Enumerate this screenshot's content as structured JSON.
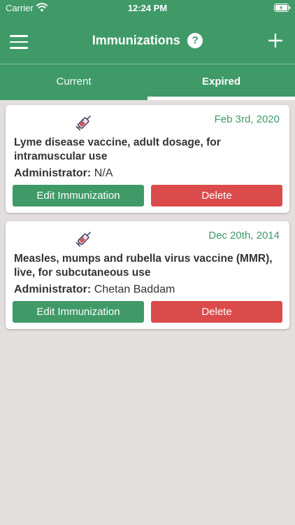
{
  "status_bar": {
    "carrier": "Carrier",
    "time": "12:24 PM"
  },
  "navbar": {
    "title": "Immunizations",
    "help_glyph": "?",
    "menu_icon": "hamburger-menu-icon",
    "add_icon": "plus-icon"
  },
  "tabs": [
    {
      "label": "Current",
      "active": false
    },
    {
      "label": "Expired",
      "active": true
    }
  ],
  "colors": {
    "primary": "#3f9a68",
    "danger": "#db4b4b",
    "background": "#e4dfdf"
  },
  "immunizations": [
    {
      "date": "Feb 3rd, 2020",
      "name": "Lyme disease vaccine, adult dosage, for intramuscular use",
      "admin_label": "Administrator:",
      "admin_value": "N/A",
      "edit_label": "Edit Immunization",
      "delete_label": "Delete"
    },
    {
      "date": "Dec 20th, 2014",
      "name": "Measles, mumps and rubella virus vaccine (MMR), live, for subcutaneous use",
      "admin_label": "Administrator:",
      "admin_value": "Chetan Baddam",
      "edit_label": "Edit Immunization",
      "delete_label": "Delete"
    }
  ]
}
